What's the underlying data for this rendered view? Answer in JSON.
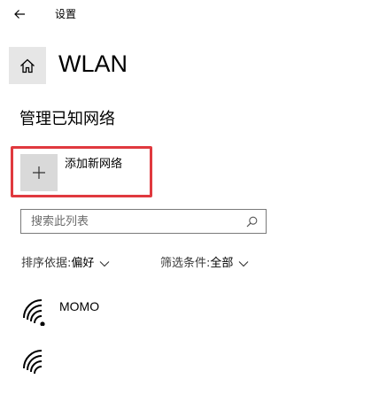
{
  "window": {
    "title": "设置"
  },
  "header": {
    "page_title": "WLAN"
  },
  "section": {
    "title": "管理已知网络"
  },
  "add_network": {
    "label": "添加新网络"
  },
  "search": {
    "placeholder": "搜索此列表",
    "value": ""
  },
  "sort": {
    "label": "排序依据:",
    "value": "偏好"
  },
  "filter": {
    "label": "筛选条件:",
    "value": "全部"
  },
  "networks": [
    {
      "name": "MOMO",
      "icon": "wifi-icon"
    },
    {
      "name": "",
      "icon": "wifi-icon"
    }
  ],
  "colors": {
    "highlight": "#e0393e",
    "tile_bg": "#e6e6e6",
    "add_tile_bg": "#d9d9d9"
  }
}
